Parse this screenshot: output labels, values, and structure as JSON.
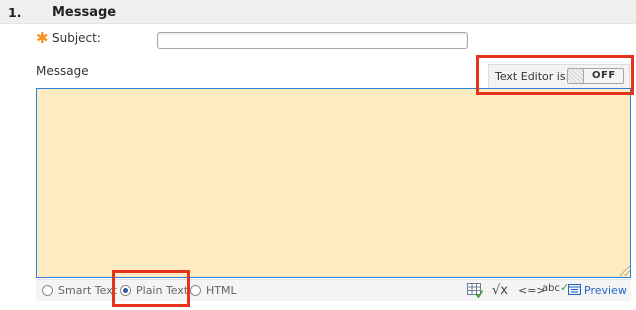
{
  "section": {
    "number": "1.",
    "title": "Message"
  },
  "subject": {
    "label": "Subject:",
    "value": "",
    "required_icon": "asterisk-icon"
  },
  "message": {
    "label": "Message",
    "value": ""
  },
  "text_editor": {
    "label": "Text Editor is:",
    "state": "OFF"
  },
  "format_options": [
    {
      "label": "Smart Text",
      "selected": false
    },
    {
      "label": "Plain Text",
      "selected": true
    },
    {
      "label": "HTML",
      "selected": false
    }
  ],
  "toolbar": {
    "icons": [
      "insert-table-icon",
      "math-formula-icon",
      "code-icon",
      "spellcheck-icon",
      "preview-icon"
    ],
    "preview_label": "Preview"
  },
  "colors": {
    "message_bg": "#fdebc2",
    "focus_border": "#2f7ed8",
    "highlight": "#e4341b",
    "required_star": "#f7931d",
    "link": "#2566c2"
  }
}
